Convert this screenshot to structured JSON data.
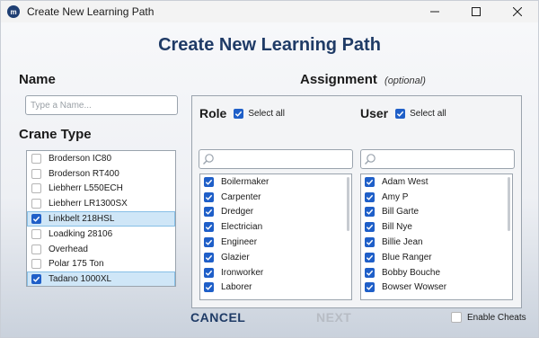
{
  "window": {
    "title": "Create New Learning Path",
    "app_icon_text": "m"
  },
  "page_title": "Create New Learning Path",
  "name_section": {
    "label": "Name",
    "placeholder": "Type a Name...",
    "value": ""
  },
  "crane_section": {
    "label": "Crane Type",
    "items": [
      {
        "label": "Broderson IC80",
        "checked": false,
        "selected": false
      },
      {
        "label": "Broderson RT400",
        "checked": false,
        "selected": false
      },
      {
        "label": "Liebherr L550ECH",
        "checked": false,
        "selected": false
      },
      {
        "label": "Liebherr LR1300SX",
        "checked": false,
        "selected": false
      },
      {
        "label": "Linkbelt 218HSL",
        "checked": true,
        "selected": true
      },
      {
        "label": "Loadking 28106",
        "checked": false,
        "selected": false
      },
      {
        "label": "Overhead",
        "checked": false,
        "selected": false
      },
      {
        "label": "Polar 175 Ton",
        "checked": false,
        "selected": false
      },
      {
        "label": "Tadano 1000XL",
        "checked": true,
        "selected": true
      }
    ]
  },
  "assignment": {
    "label": "Assignment",
    "optional_label": "(optional)",
    "role": {
      "header": "Role",
      "select_all_label": "Select all",
      "select_all_checked": true,
      "search_placeholder": "",
      "items": [
        "Boilermaker",
        "Carpenter",
        "Dredger",
        "Electrician",
        "Engineer",
        "Glazier",
        "Ironworker",
        "Laborer"
      ]
    },
    "user": {
      "header": "User",
      "select_all_label": "Select all",
      "select_all_checked": true,
      "search_placeholder": "",
      "items": [
        "Adam West",
        "Amy P",
        "Bill Garte",
        "Bill Nye",
        "Billie Jean",
        "Blue Ranger",
        "Bobby Bouche",
        "Bowser Wowser"
      ]
    }
  },
  "footer": {
    "cancel_label": "CANCEL",
    "next_label": "NEXT",
    "enable_cheats_label": "Enable Cheats",
    "enable_cheats_checked": false
  },
  "colors": {
    "title_blue": "#1f3b66",
    "checkbox_blue": "#1f5fc8",
    "selected_row": "#cfe6f7",
    "disabled_text": "#b7bcc4"
  }
}
